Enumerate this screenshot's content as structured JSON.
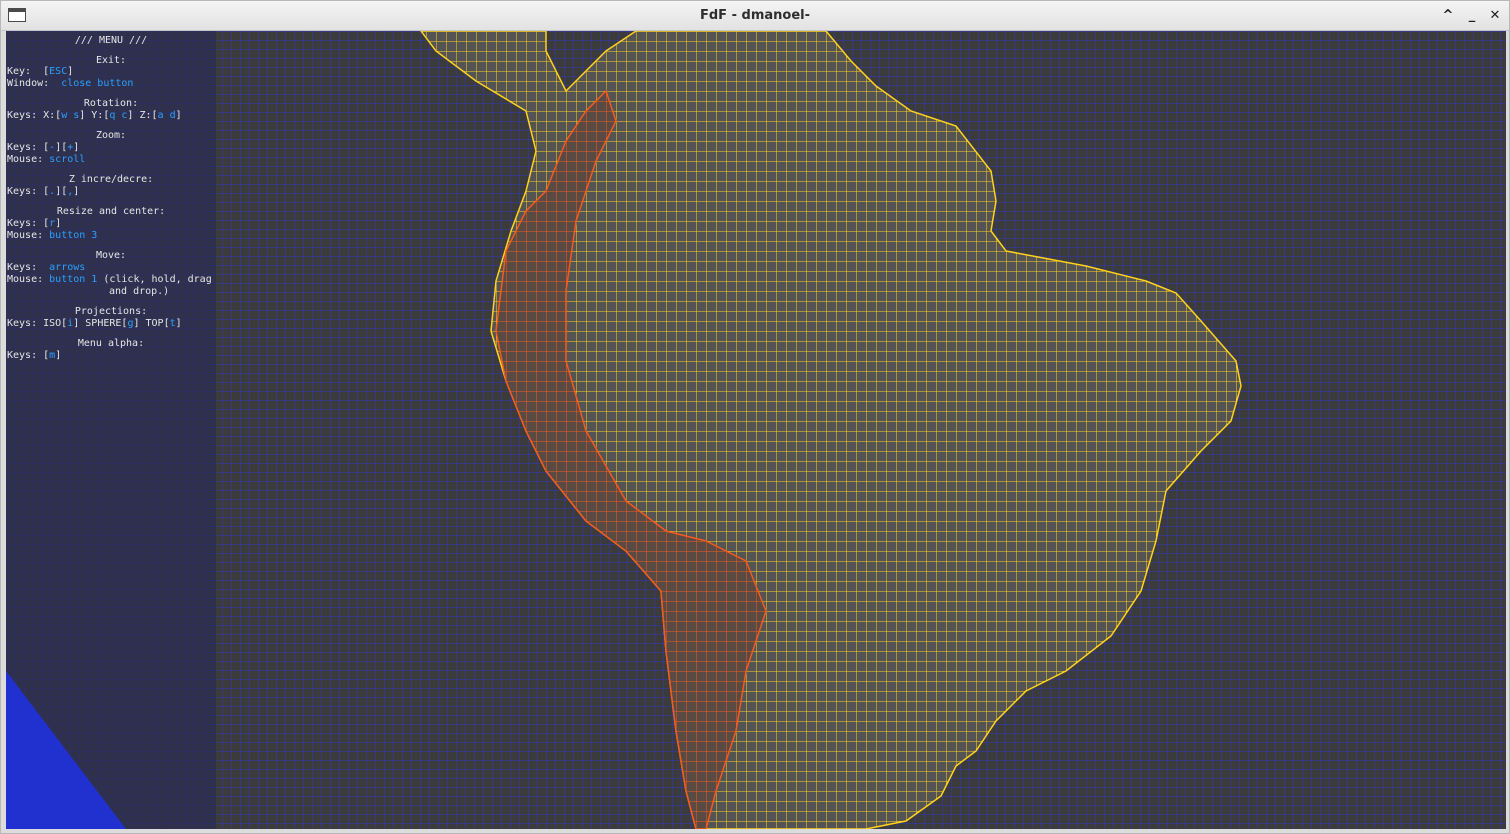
{
  "window": {
    "title": "FdF - dmanoel-",
    "controls": {
      "maximize": "^",
      "minimize": "_",
      "close": "✕"
    }
  },
  "colors": {
    "ocean_grid": "#3237c6",
    "land_grid": "#ffd21c",
    "mountain_grid": "#f45a1e",
    "menu_panel": "#2a2d52",
    "background": "#3b3b3b",
    "key_text": "#2aa0ff"
  },
  "menu": {
    "title": "/// MENU ///",
    "exit": {
      "heading": "Exit:",
      "key_prefix": "Key:  [",
      "key": "ESC",
      "key_suffix": "]",
      "window_prefix": "Window:  ",
      "window": "close button"
    },
    "rotation": {
      "heading": "Rotation:",
      "p1": "Keys: X:[",
      "k1": "w s",
      "p2": "] Y:[",
      "k2": "q c",
      "p3": "] Z:[",
      "k3": "a d",
      "p4": "]"
    },
    "zoom": {
      "heading": "Zoom:",
      "p1": "Keys: [",
      "k1": "-",
      "p2": "][",
      "k2": "+",
      "p3": "]",
      "mouse_prefix": "Mouse: ",
      "mouse": "scroll"
    },
    "z": {
      "heading": "Z incre/decre:",
      "p1": "Keys: [",
      "k1": ".",
      "p2": "][",
      "k2": ",",
      "p3": "]"
    },
    "resize": {
      "heading": "Resize and center:",
      "p1": "Keys: [",
      "k1": "r",
      "p2": "]",
      "mouse_prefix": "Mouse: ",
      "mouse": "button 3"
    },
    "move": {
      "heading": "Move:",
      "keys_prefix": "Keys:  ",
      "keys": "arrows",
      "mouse_prefix": "Mouse: ",
      "mouse": "button 1",
      "mouse_suffix": " (click, hold, drag",
      "mouse_cont": "and drop.)"
    },
    "projections": {
      "heading": "Projections:",
      "p1": "Keys: ISO[",
      "k1": "i",
      "p2": "] SPHERE[",
      "k2": "g",
      "p3": "] TOP[",
      "k3": "t",
      "p4": "]"
    },
    "alpha": {
      "heading": "Menu alpha:",
      "p1": "Keys: [",
      "k1": "m",
      "p2": "]"
    }
  }
}
